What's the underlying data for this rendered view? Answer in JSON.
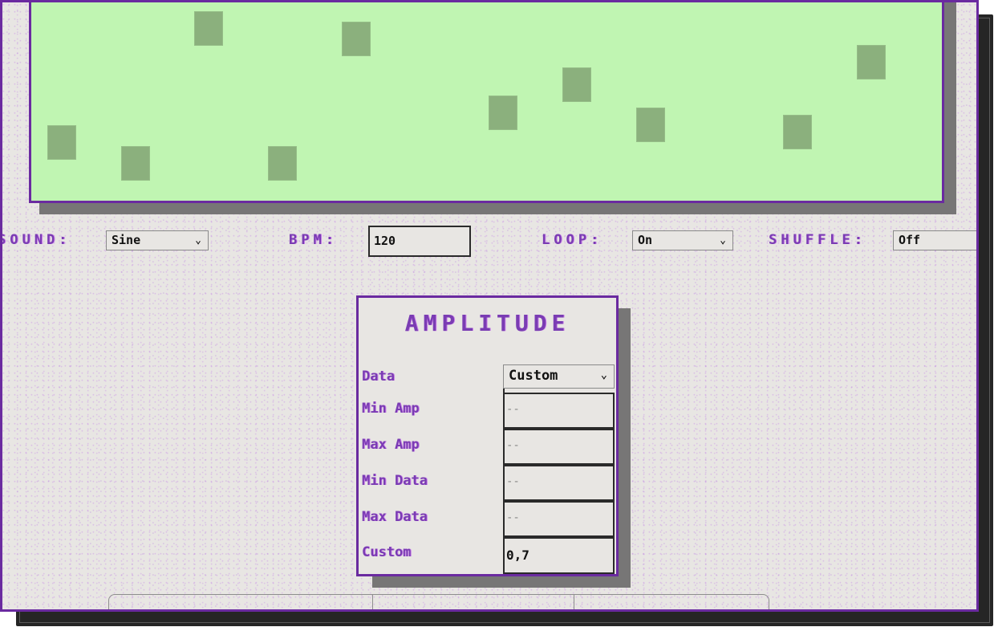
{
  "sequencer": {
    "steps": 12,
    "active_levels": [
      0.29,
      0.17,
      0.94,
      0.17,
      0.88,
      null,
      0.46,
      0.62,
      0.39,
      null,
      0.35,
      0.75
    ],
    "colors": {
      "background": "#c0f5b2",
      "block": "#8bb07d",
      "border": "#6a2aa0"
    }
  },
  "controls": {
    "sound": {
      "label": "SOUND:",
      "value": "Sine"
    },
    "bpm": {
      "label": "BPM:",
      "value": "120"
    },
    "loop": {
      "label": "LOOP:",
      "value": "On"
    },
    "shuffle": {
      "label": "SHUFFLE:",
      "value": "Off"
    }
  },
  "amplitude": {
    "title": "AMPLITUDE",
    "data": {
      "label": "Data",
      "value": "Custom"
    },
    "min_amp": {
      "label": "Min Amp",
      "value": "--"
    },
    "max_amp": {
      "label": "Max Amp",
      "value": "--"
    },
    "min_data": {
      "label": "Min Data",
      "value": "--"
    },
    "max_data": {
      "label": "Max Data",
      "value": "--"
    },
    "custom": {
      "label": "Custom",
      "value": "0,7"
    }
  },
  "icons": {
    "chevron": "⌄"
  },
  "theme": {
    "accent": "#6a2aa0",
    "label_color": "#7a3cb3",
    "panel_bg": "#e8e6e3",
    "shadow": "#777676"
  }
}
